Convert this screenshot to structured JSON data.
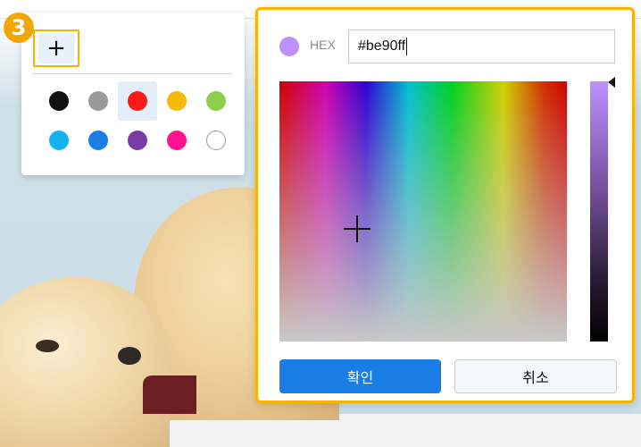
{
  "step_badge": "3",
  "swatch_panel": {
    "add_button_label": "+",
    "swatches": [
      {
        "name": "black",
        "color": "#111111",
        "selected": false
      },
      {
        "name": "gray",
        "color": "#9a9a9a",
        "selected": false
      },
      {
        "name": "red",
        "color": "#ff1a1a",
        "selected": true
      },
      {
        "name": "yellow",
        "color": "#f7b90a",
        "selected": false
      },
      {
        "name": "green",
        "color": "#8ccf4a",
        "selected": false
      },
      {
        "name": "sky-blue",
        "color": "#14b3f0",
        "selected": false
      },
      {
        "name": "blue",
        "color": "#1a7ee6",
        "selected": false
      },
      {
        "name": "purple",
        "color": "#7a3aa8",
        "selected": false
      },
      {
        "name": "pink",
        "color": "#ff138f",
        "selected": false
      },
      {
        "name": "white",
        "color": "#ffffff",
        "selected": false
      }
    ]
  },
  "picker": {
    "preview_color": "#be90ff",
    "hex_label": "HEX",
    "hex_value": "#be90ff",
    "confirm_label": "확인",
    "cancel_label": "취소",
    "accent_color": "#f4b400"
  }
}
